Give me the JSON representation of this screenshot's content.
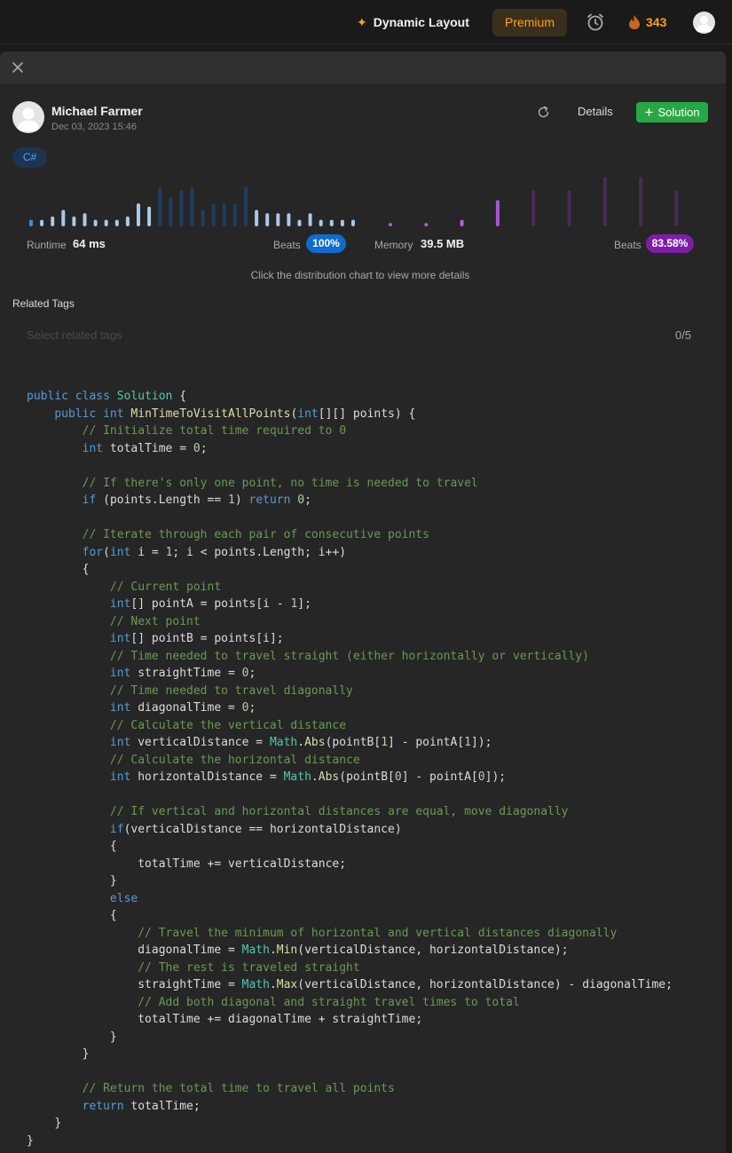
{
  "topbar": {
    "dynamic_layout_label": "Dynamic Layout",
    "premium_label": "Premium",
    "streak_count": "343",
    "icons": [
      "sparkle-icon",
      "alarm-clock-icon",
      "fire-icon",
      "avatar"
    ]
  },
  "submission": {
    "author": "Michael Farmer",
    "date": "Dec 03, 2023 15:46",
    "details_label": "Details",
    "solution_label": "Solution",
    "language": "C#"
  },
  "stats": {
    "runtime_label": "Runtime",
    "runtime_value": "64 ms",
    "runtime_beats_label": "Beats",
    "runtime_beats": "100%",
    "memory_label": "Memory",
    "memory_value": "39.5 MB",
    "memory_beats_label": "Beats",
    "memory_beats": "83.58%",
    "hint": "Click the distribution chart to view more details"
  },
  "chart_data": [
    {
      "type": "bar",
      "values": [
        2,
        2,
        3,
        5,
        3,
        4,
        2,
        2,
        2,
        3,
        7,
        6,
        12,
        9,
        11,
        12,
        5,
        7,
        7,
        7,
        12,
        5,
        4,
        4,
        4,
        2,
        4,
        2,
        2,
        2,
        2
      ],
      "highlight_index": 0,
      "colors": {
        "highlight": "#3d8edb",
        "bar": "#a9c9e8",
        "dim": "#1f3d5e"
      },
      "dim_range": [
        12,
        20
      ]
    },
    {
      "type": "bar",
      "values": [
        1,
        1,
        2,
        8,
        11,
        11,
        15,
        15,
        11
      ],
      "highlight_index": 3,
      "colors": {
        "highlight": "#a855d9",
        "bar": "#b464d9",
        "dim": "#4a2a5a"
      },
      "dim_range": [
        4,
        8
      ]
    }
  ],
  "tags": {
    "title": "Related Tags",
    "placeholder": "Select related tags",
    "count": "0/5"
  },
  "code": {
    "language": "csharp",
    "lines": [
      "public class Solution {",
      "    public int MinTimeToVisitAllPoints(int[][] points) {",
      "        // Initialize total time required to 0",
      "        int totalTime = 0;",
      "",
      "        // If there's only one point, no time is needed to travel",
      "        if (points.Length == 1) return 0;",
      "",
      "        // Iterate through each pair of consecutive points",
      "        for(int i = 1; i < points.Length; i++)",
      "        {",
      "            // Current point",
      "            int[] pointA = points[i - 1];",
      "            // Next point",
      "            int[] pointB = points[i];",
      "            // Time needed to travel straight (either horizontally or vertically)",
      "            int straightTime = 0;",
      "            // Time needed to travel diagonally",
      "            int diagonalTime = 0;",
      "            // Calculate the vertical distance",
      "            int verticalDistance = Math.Abs(pointB[1] - pointA[1]);",
      "            // Calculate the horizontal distance",
      "            int horizontalDistance = Math.Abs(pointB[0] - pointA[0]);",
      "",
      "            // If vertical and horizontal distances are equal, move diagonally",
      "            if(verticalDistance == horizontalDistance)",
      "            {",
      "                totalTime += verticalDistance;",
      "            }",
      "            else",
      "            {",
      "                // Travel the minimum of horizontal and vertical distances diagonally",
      "                diagonalTime = Math.Min(verticalDistance, horizontalDistance);",
      "                // The rest is traveled straight",
      "                straightTime = Math.Max(verticalDistance, horizontalDistance) - diagonalTime;",
      "                // Add both diagonal and straight travel times to total",
      "                totalTime += diagonalTime + straightTime;",
      "            }",
      "        }",
      "",
      "        // Return the total time to travel all points",
      "        return totalTime;",
      "    }",
      "}"
    ]
  }
}
